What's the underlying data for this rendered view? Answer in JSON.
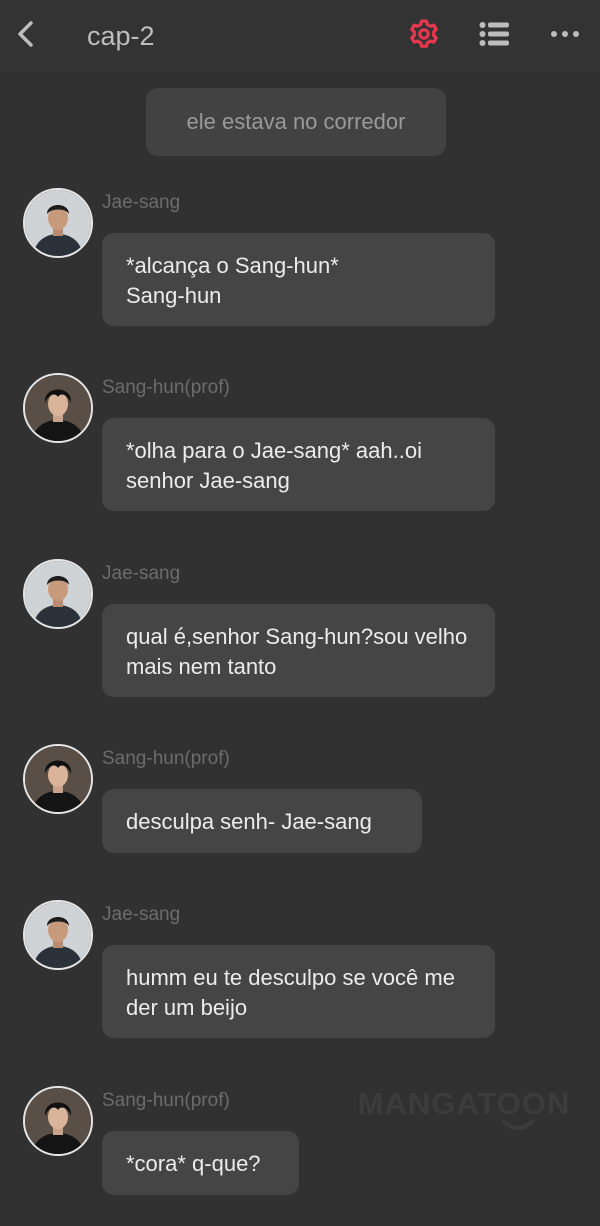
{
  "header": {
    "title": "cap-2",
    "back_icon": "chevron-left-icon",
    "settings_icon": "gear-icon",
    "list_icon": "list-icon",
    "more_icon": "more-dots-icon",
    "accent": "#e8364e"
  },
  "narration": "ele estava no corredor",
  "messages": [
    {
      "name": "Jae-sang",
      "avatar": "avatar-jae-sang",
      "text": "*alcança o Sang-hun*\nSang-hun"
    },
    {
      "name": "Sang-hun(prof)",
      "avatar": "avatar-sang-hun",
      "text": "*olha para o Jae-sang* aah..oi senhor Jae-sang"
    },
    {
      "name": "Jae-sang",
      "avatar": "avatar-jae-sang",
      "text": "qual é,senhor Sang-hun?sou velho mais nem tanto"
    },
    {
      "name": "Sang-hun(prof)",
      "avatar": "avatar-sang-hun",
      "text": "desculpa senh- Jae-sang"
    },
    {
      "name": "Jae-sang",
      "avatar": "avatar-jae-sang",
      "text": "humm eu te desculpo se você me der um beijo"
    },
    {
      "name": "Sang-hun(prof)",
      "avatar": "avatar-sang-hun",
      "text": "*cora* q-que?"
    }
  ],
  "watermark": "MANGATOON"
}
